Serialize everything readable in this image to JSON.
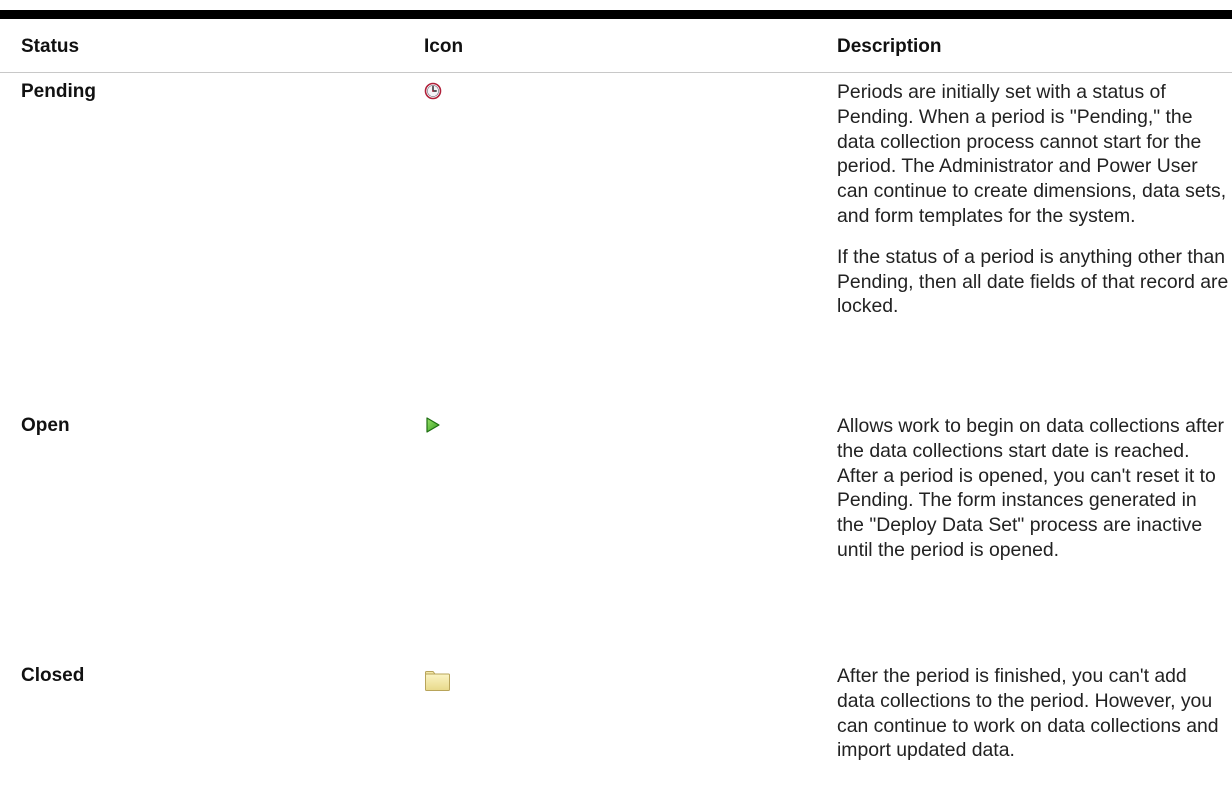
{
  "table": {
    "headers": {
      "status": "Status",
      "icon": "Icon",
      "description": "Description"
    },
    "rows": [
      {
        "status": "Pending",
        "icon": "clock-icon",
        "description": [
          "Periods are initially set with a status of Pending. When a period is \"Pending,\" the data collection process cannot start for the period. The Administrator and Power User can continue to create dimensions, data sets, and form templates for the system.",
          "If the status of a period is anything other than Pending, then all date fields of that record are locked."
        ]
      },
      {
        "status": "Open",
        "icon": "green-play-arrow-icon",
        "description": [
          "Allows work to begin on data collections after the data collections start date is reached. After a period is opened, you can't reset it to Pending. The form instances generated in the \"Deploy Data Set\" process are inactive until the period is opened."
        ]
      },
      {
        "status": "Closed",
        "icon": "folder-icon",
        "description": [
          "After the period is finished, you can't add data collections to the period. However, you can continue to work on data collections and import updated data."
        ]
      }
    ]
  }
}
